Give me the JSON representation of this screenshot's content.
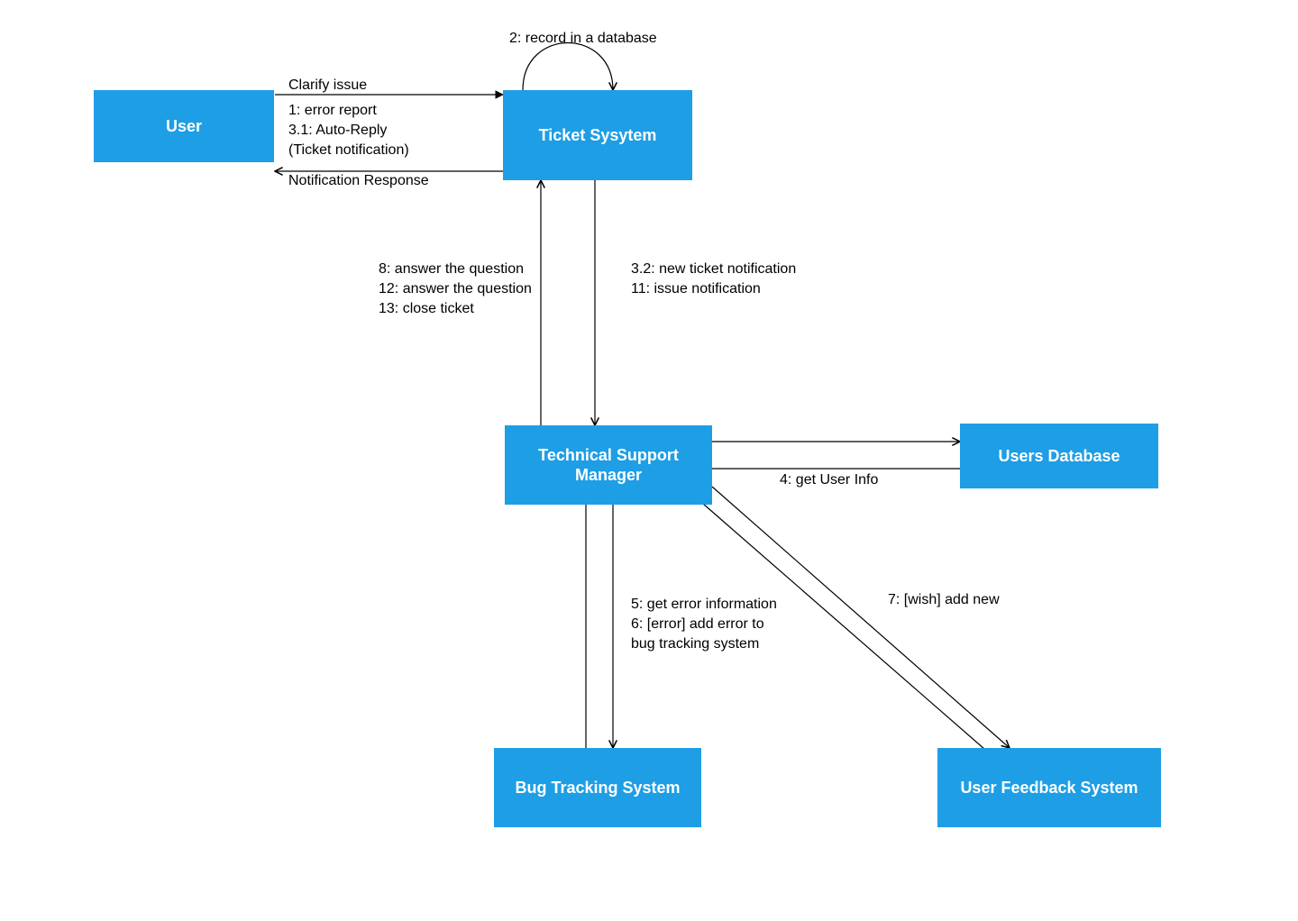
{
  "nodes": {
    "user": {
      "label": "User"
    },
    "ticket_system": {
      "label": "Ticket Sysytem"
    },
    "tech_support_manager": {
      "label": "Technical Support Manager"
    },
    "users_database": {
      "label": "Users Database"
    },
    "bug_tracking_system": {
      "label": "Bug Tracking System"
    },
    "user_feedback_system": {
      "label": "User Feedback System"
    }
  },
  "edges": {
    "user_to_ticket_top": "Clarify issue",
    "user_to_ticket_mid_line1": "1: error report",
    "user_to_ticket_mid_line2": "3.1: Auto-Reply",
    "user_to_ticket_mid_line3": "(Ticket notification)",
    "ticket_to_user_bottom": "Notification Response",
    "ticket_self_loop": "2: record in a database",
    "tsm_to_ticket_line1": "8: answer the question",
    "tsm_to_ticket_line2": "12: answer the question",
    "tsm_to_ticket_line3": "13: close ticket",
    "ticket_to_tsm_line1": "3.2: new ticket notification",
    "ticket_to_tsm_line2": "11: issue notification",
    "tsm_to_usersdb": "4: get User Info",
    "tsm_to_bts_line1": "5: get error information",
    "tsm_to_bts_line2": "6: [error] add error to",
    "tsm_to_bts_line3": "bug tracking system",
    "tsm_to_ufs": "7: [wish] add new"
  },
  "colors": {
    "node_fill": "#1e9ee5",
    "node_text": "#ffffff",
    "edge": "#000000"
  }
}
